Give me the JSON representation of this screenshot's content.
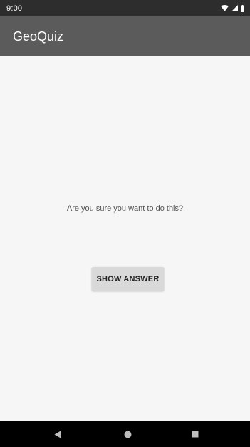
{
  "status_bar": {
    "time": "9:00",
    "icons": [
      "wifi-icon",
      "signal-icon",
      "battery-icon"
    ]
  },
  "app_bar": {
    "title": "GeoQuiz"
  },
  "main": {
    "question_text": "Are you sure you want to do this?",
    "show_answer_label": "SHOW ANSWER"
  },
  "nav_bar": {
    "buttons": [
      "back-icon",
      "home-icon",
      "recents-icon"
    ]
  },
  "colors": {
    "status_bar": "#2d2d2d",
    "app_bar": "#5b5b5b",
    "background": "#f6f6f6",
    "button": "#d9d9d9",
    "nav_bar": "#000000"
  }
}
